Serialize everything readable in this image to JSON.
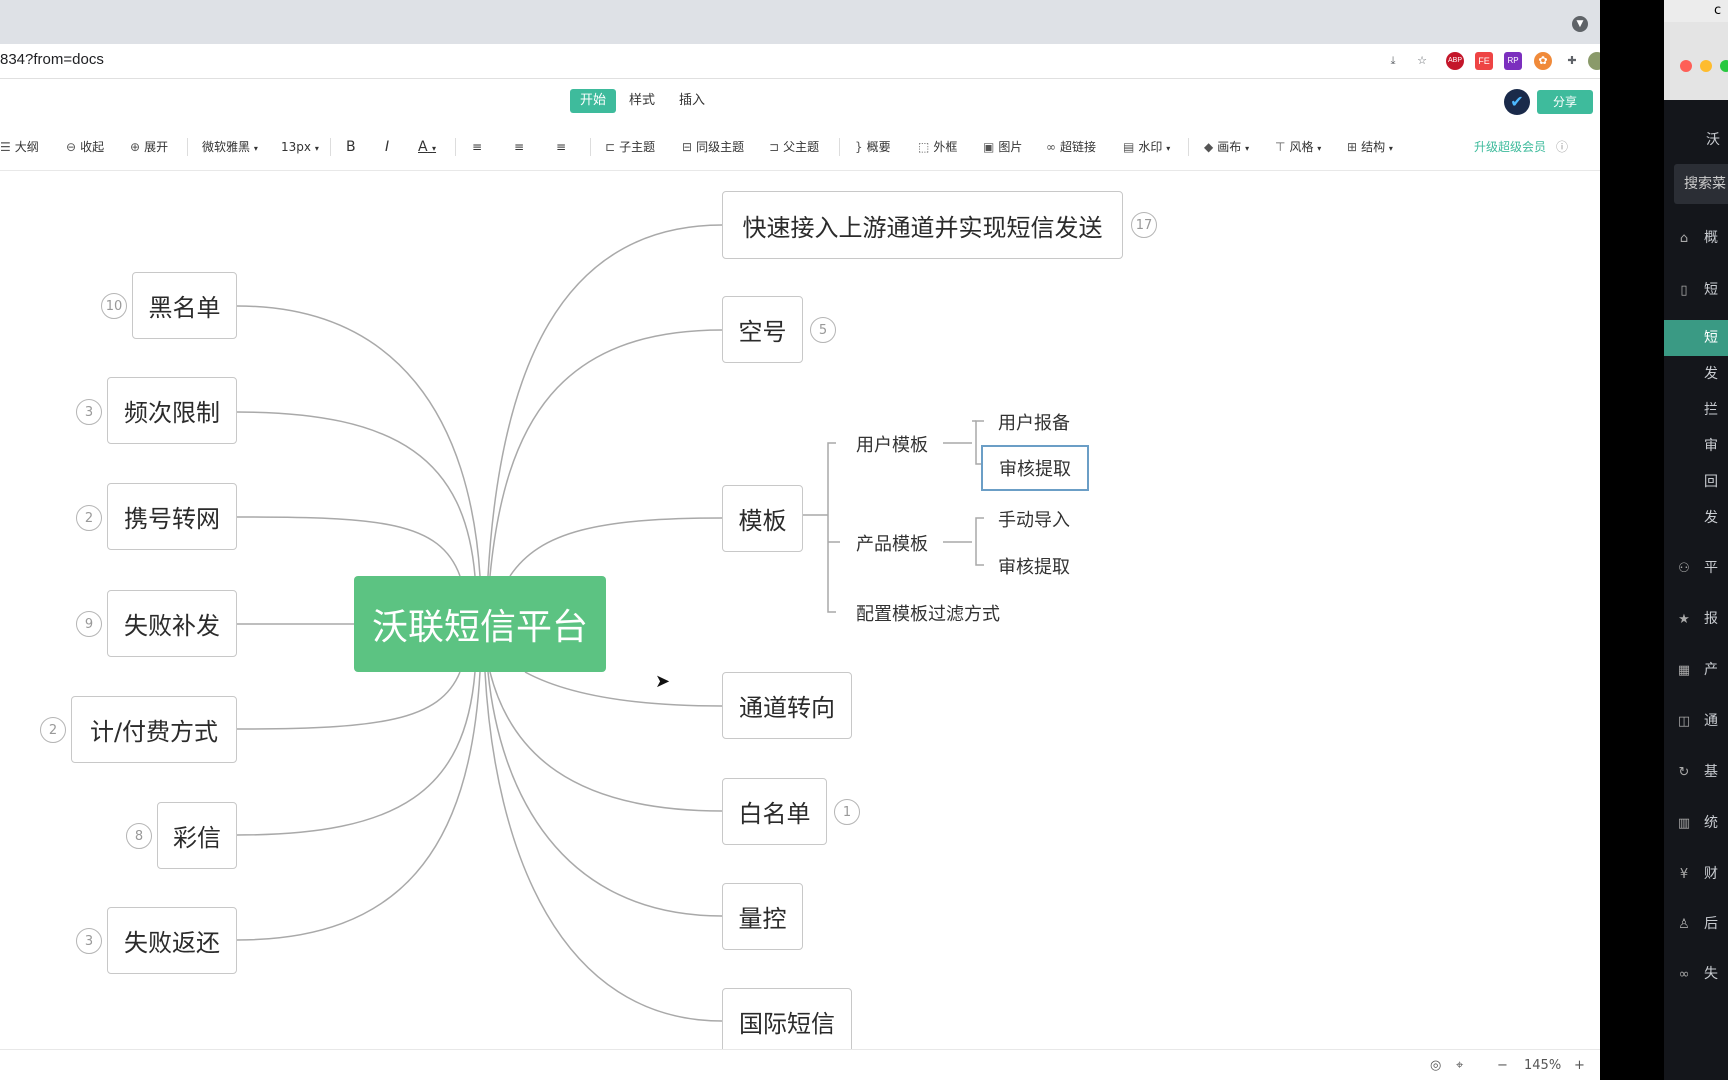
{
  "browser": {
    "url": "834?from=docs",
    "toolbar_icons": [
      "download-icon",
      "star-icon",
      "abp-icon",
      "fe-icon",
      "rp-icon",
      "extension-icon",
      "puzzle-icon",
      "profile-icon",
      "menu-icon"
    ],
    "abp_label": "ABP",
    "fe_label": "FE",
    "rp_label": "RP"
  },
  "app": {
    "tabs": [
      {
        "label": "开始",
        "active": true
      },
      {
        "label": "样式",
        "active": false
      },
      {
        "label": "插入",
        "active": false
      }
    ],
    "share_label": "分享",
    "avatar_glyph": "✔"
  },
  "edit_toolbar": {
    "outline": "大纲",
    "collapse": "收起",
    "expand": "展开",
    "font": "微软雅黑",
    "font_size": "13px",
    "bold": "B",
    "italic": "I",
    "font_color": "A",
    "child_topic": "子主题",
    "sibling_topic": "同级主题",
    "parent_topic": "父主题",
    "summary": "概要",
    "frame": "外框",
    "image": "图片",
    "hyperlink": "超链接",
    "watermark": "水印",
    "canvas": "画布",
    "style": "风格",
    "structure": "结构",
    "upgrade": "升级超级会员"
  },
  "mindmap": {
    "root": "沃联短信平台",
    "left_nodes": [
      {
        "label": "黑名单",
        "count": "10"
      },
      {
        "label": "频次限制",
        "count": "3"
      },
      {
        "label": "携号转网",
        "count": "2"
      },
      {
        "label": "失败补发",
        "count": "9"
      },
      {
        "label": "计/付费方式",
        "count": "2"
      },
      {
        "label": "彩信",
        "count": "8"
      },
      {
        "label": "失败返还",
        "count": "3"
      }
    ],
    "right_nodes": [
      {
        "label": "快速接入上游通道并实现短信发送",
        "count": "17"
      },
      {
        "label": "空号",
        "count": "5"
      },
      {
        "label": "模板",
        "count": ""
      },
      {
        "label": "通道转向",
        "count": ""
      },
      {
        "label": "白名单",
        "count": "1"
      },
      {
        "label": "量控",
        "count": ""
      },
      {
        "label": "国际短信",
        "count": ""
      }
    ],
    "template_children": {
      "user_template": "用户模板",
      "user_report": "用户报备",
      "review_extract_1": "审核提取",
      "product_template": "产品模板",
      "manual_import": "手动导入",
      "review_extract_2": "审核提取",
      "filter_config": "配置模板过滤方式"
    }
  },
  "statusbar": {
    "zoom": "145%",
    "minus": "−",
    "plus": "+"
  },
  "right_window": {
    "menu_text": "c",
    "search": "搜索菜",
    "nav": [
      {
        "label": "概",
        "icon": "home-icon"
      },
      {
        "label": "短",
        "icon": "phone-icon"
      },
      {
        "label": "短",
        "icon": "",
        "active": true
      },
      {
        "label": "发",
        "icon": ""
      },
      {
        "label": "拦",
        "icon": ""
      },
      {
        "label": "审",
        "icon": ""
      },
      {
        "label": "回",
        "icon": ""
      },
      {
        "label": "发",
        "icon": ""
      },
      {
        "label": "平",
        "icon": "users-icon"
      },
      {
        "label": "报",
        "icon": "star-icon"
      },
      {
        "label": "产",
        "icon": "grid-icon"
      },
      {
        "label": "通",
        "icon": "columns-icon"
      },
      {
        "label": "基",
        "icon": "refresh-icon"
      },
      {
        "label": "统",
        "icon": "table-icon"
      },
      {
        "label": "财",
        "icon": "yen-icon"
      },
      {
        "label": "后",
        "icon": "user-icon"
      },
      {
        "label": "失",
        "icon": "link-icon"
      }
    ],
    "top_label": "沃"
  }
}
